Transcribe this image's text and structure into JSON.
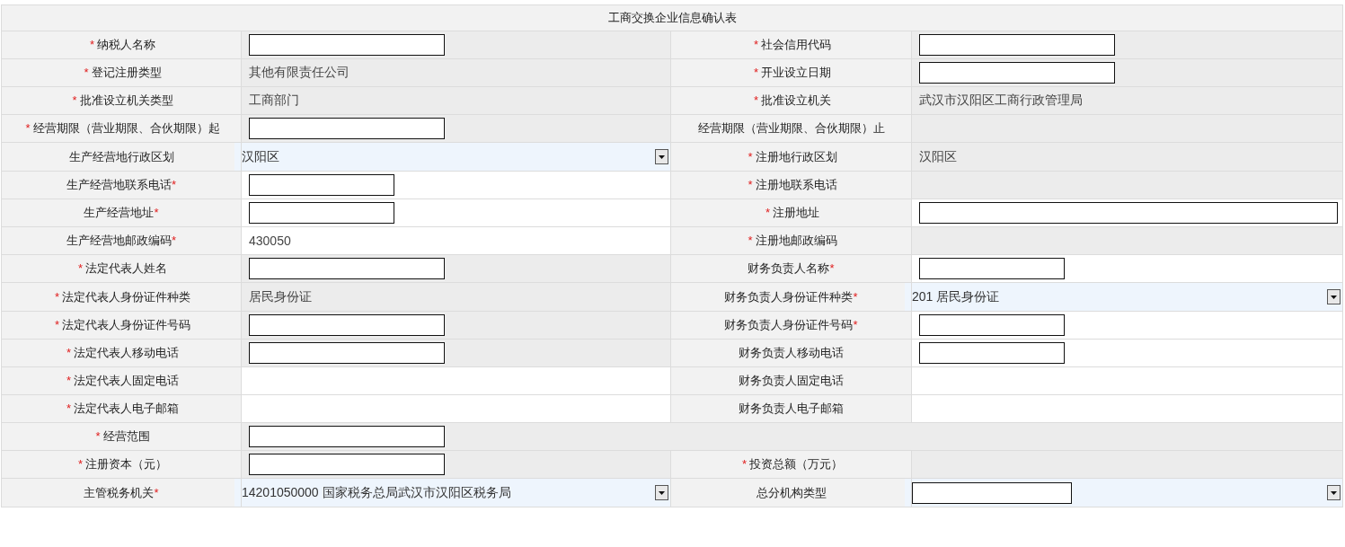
{
  "title": "工商交换企业信息确认表",
  "rows": [
    {
      "cells": [
        {
          "label": "纳税人名称",
          "mark": "*",
          "mark_first": true,
          "value": {
            "kind": "masked"
          }
        },
        {
          "label": "社会信用代码",
          "mark": "*",
          "mark_first": true,
          "value": {
            "kind": "masked"
          }
        }
      ]
    },
    {
      "cells": [
        {
          "label": "登记注册类型",
          "mark": "*",
          "mark_first": true,
          "value": {
            "kind": "text",
            "text": "其他有限责任公司"
          }
        },
        {
          "label": "开业设立日期",
          "mark": "*",
          "mark_first": true,
          "value": {
            "kind": "masked"
          }
        }
      ]
    },
    {
      "cells": [
        {
          "label": "批准设立机关类型",
          "mark": "*",
          "mark_first": true,
          "value": {
            "kind": "text",
            "text": "工商部门"
          }
        },
        {
          "label": "批准设立机关",
          "mark": "*",
          "mark_first": true,
          "value": {
            "kind": "text",
            "text": "武汉市汉阳区工商行政管理局"
          }
        }
      ]
    },
    {
      "cells": [
        {
          "label": "经营期限（营业期限、合伙期限）起",
          "mark": "*",
          "mark_first": true,
          "value": {
            "kind": "masked"
          }
        },
        {
          "label": "经营期限（营业期限、合伙期限）止",
          "value": {
            "kind": "empty"
          }
        }
      ]
    },
    {
      "cells": [
        {
          "label": "生产经营地行政区划",
          "value": {
            "kind": "select",
            "text": "汉阳区"
          }
        },
        {
          "label": "注册地行政区划",
          "mark": "*",
          "mark_first": true,
          "value": {
            "kind": "text",
            "text": "汉阳区"
          }
        }
      ]
    },
    {
      "cells": [
        {
          "label": "生产经营地联系电话",
          "mark": "*",
          "mark_first": false,
          "value": {
            "kind": "input"
          }
        },
        {
          "label": "注册地联系电话",
          "mark": "*",
          "mark_first": true,
          "value": {
            "kind": "empty"
          }
        }
      ]
    },
    {
      "cells": [
        {
          "label": "生产经营地址",
          "mark": "*",
          "mark_first": false,
          "value": {
            "kind": "input"
          }
        },
        {
          "label": "注册地址",
          "mark": "*",
          "mark_first": true,
          "value": {
            "kind": "long_input"
          }
        }
      ]
    },
    {
      "cells": [
        {
          "label": "生产经营地邮政编码",
          "mark": "*",
          "mark_first": false,
          "value": {
            "kind": "text_white",
            "text": "430050"
          }
        },
        {
          "label": "注册地邮政编码",
          "mark": "*",
          "mark_first": true,
          "value": {
            "kind": "empty"
          }
        }
      ]
    },
    {
      "cells": [
        {
          "label": "法定代表人姓名",
          "mark": "*",
          "mark_first": true,
          "value": {
            "kind": "masked"
          }
        },
        {
          "label": "财务负责人名称",
          "mark": "*",
          "mark_first": false,
          "value": {
            "kind": "input"
          }
        }
      ]
    },
    {
      "cells": [
        {
          "label": "法定代表人身份证件种类",
          "mark": "*",
          "mark_first": true,
          "value": {
            "kind": "text",
            "text": "居民身份证"
          }
        },
        {
          "label": "财务负责人身份证件种类",
          "mark": "*",
          "mark_first": false,
          "value": {
            "kind": "select",
            "text": "201 居民身份证"
          }
        }
      ]
    },
    {
      "cells": [
        {
          "label": "法定代表人身份证件号码",
          "mark": "*",
          "mark_first": true,
          "value": {
            "kind": "masked"
          }
        },
        {
          "label": "财务负责人身份证件号码",
          "mark": "*",
          "mark_first": false,
          "value": {
            "kind": "input"
          }
        }
      ]
    },
    {
      "cells": [
        {
          "label": "法定代表人移动电话",
          "mark": "*",
          "mark_first": true,
          "value": {
            "kind": "masked"
          }
        },
        {
          "label": "财务负责人移动电话",
          "value": {
            "kind": "input"
          }
        }
      ]
    },
    {
      "cells": [
        {
          "label": "法定代表人固定电话",
          "mark": "*",
          "mark_first": true,
          "value": {
            "kind": "blank"
          }
        },
        {
          "label": "财务负责人固定电话",
          "value": {
            "kind": "blank"
          }
        }
      ]
    },
    {
      "cells": [
        {
          "label": "法定代表人电子邮箱",
          "mark": "*",
          "mark_first": true,
          "value": {
            "kind": "blank"
          }
        },
        {
          "label": "财务负责人电子邮箱",
          "value": {
            "kind": "blank"
          }
        }
      ]
    },
    {
      "cells": [
        {
          "label": "经营范围",
          "mark": "*",
          "mark_first": true,
          "value": {
            "kind": "masked"
          }
        }
      ]
    },
    {
      "cells": [
        {
          "label": "注册资本（元）",
          "mark": "*",
          "mark_first": true,
          "value": {
            "kind": "masked"
          }
        },
        {
          "label": "投资总额（万元）",
          "mark": "*",
          "mark_first": true,
          "value": {
            "kind": "empty"
          }
        }
      ]
    },
    {
      "cells": [
        {
          "label": "主管税务机关",
          "mark": "*",
          "mark_first": false,
          "value": {
            "kind": "select",
            "text": "14201050000 国家税务总局武汉市汉阳区税务局"
          }
        },
        {
          "label": "总分机构类型",
          "value": {
            "kind": "select_masked"
          }
        }
      ]
    }
  ]
}
